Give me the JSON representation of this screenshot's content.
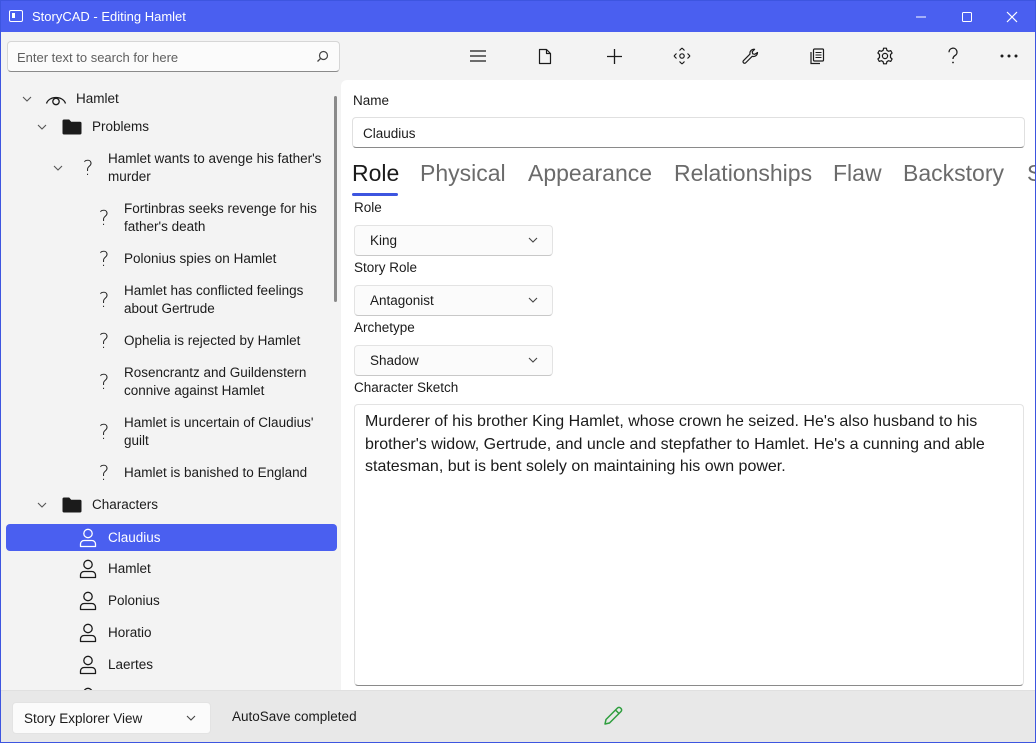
{
  "window": {
    "title": "StoryCAD - Editing Hamlet",
    "minimize_icon": "minimize-icon",
    "maximize_icon": "maximize-icon",
    "close_icon": "close-icon"
  },
  "search": {
    "placeholder": "Enter text to search for here",
    "icon": "search-icon"
  },
  "toolbar": {
    "buttons": [
      {
        "name": "menu",
        "icon": "hamburger-menu-icon"
      },
      {
        "name": "file",
        "icon": "file-icon"
      },
      {
        "name": "add",
        "icon": "plus-icon"
      },
      {
        "name": "move",
        "icon": "move-arrows-icon"
      },
      {
        "name": "tools",
        "icon": "wrench-icon"
      },
      {
        "name": "reports",
        "icon": "copy-documents-icon"
      },
      {
        "name": "settings",
        "icon": "gear-icon"
      },
      {
        "name": "help",
        "icon": "help-icon"
      },
      {
        "name": "more",
        "icon": "more-ellipsis-icon"
      }
    ]
  },
  "tree": {
    "items": [
      {
        "label": "Hamlet",
        "icon": "eye-icon",
        "expanded": true
      },
      {
        "label": "Problems",
        "icon": "folder-icon",
        "expanded": true
      },
      {
        "label": "Hamlet wants to avenge his father's murder",
        "icon": "question-icon",
        "expanded": true
      },
      {
        "label": "Fortinbras seeks revenge for his father's death",
        "icon": "question-icon"
      },
      {
        "label": "Polonius spies on Hamlet",
        "icon": "question-icon"
      },
      {
        "label": "Hamlet has conflicted feelings about Gertrude",
        "icon": "question-icon"
      },
      {
        "label": "Ophelia is rejected by Hamlet",
        "icon": "question-icon"
      },
      {
        "label": "Rosencrantz and Guildenstern connive against Hamlet",
        "icon": "question-icon"
      },
      {
        "label": "Hamlet is uncertain of Claudius' guilt",
        "icon": "question-icon"
      },
      {
        "label": "Hamlet is banished to England",
        "icon": "question-icon"
      },
      {
        "label": "Characters",
        "icon": "folder-icon",
        "expanded": true
      },
      {
        "label": "Claudius",
        "icon": "person-icon",
        "selected": true
      },
      {
        "label": "Hamlet",
        "icon": "person-icon"
      },
      {
        "label": "Polonius",
        "icon": "person-icon"
      },
      {
        "label": "Horatio",
        "icon": "person-icon"
      },
      {
        "label": "Laertes",
        "icon": "person-icon"
      }
    ]
  },
  "form": {
    "name_label": "Name",
    "name_value": "Claudius",
    "tabs": [
      "Role",
      "Physical",
      "Appearance",
      "Relationships",
      "Flaw",
      "Backstory",
      "S"
    ],
    "active_tab": "Role",
    "role_label": "Role",
    "role_value": "King",
    "story_role_label": "Story Role",
    "story_role_value": "Antagonist",
    "archetype_label": "Archetype",
    "archetype_value": "Shadow",
    "sketch_label": "Character Sketch",
    "sketch_text": "Murderer of his brother King Hamlet, whose crown he seized. He's also husband to his brother's widow, Gertrude, and uncle and stepfather to Hamlet. He's a cunning and able statesman, but is bent solely on maintaining his own power."
  },
  "status": {
    "view_selector": "Story Explorer View",
    "message": "AutoSave completed",
    "edit_icon": "pencil-icon"
  },
  "colors": {
    "accent": "#4a5ff0",
    "tab_underline": "#3d55e0",
    "edit_icon": "#2e9e3e"
  }
}
